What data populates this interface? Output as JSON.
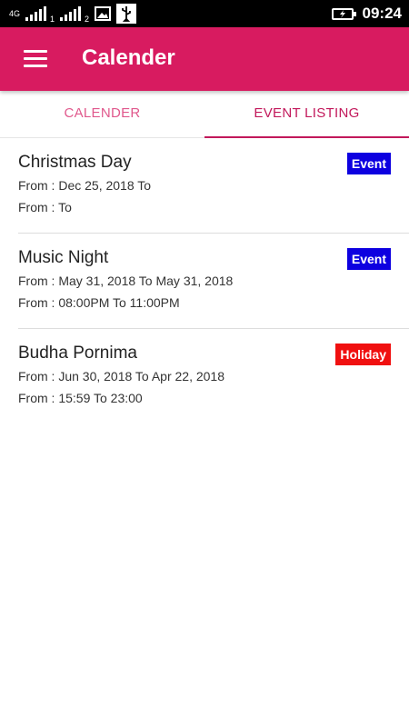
{
  "status_bar": {
    "network_type": "4G",
    "sim1": "1",
    "sim2": "2",
    "time": "09:24",
    "icons": [
      "signal-icon",
      "gallery-icon",
      "usb-icon",
      "battery-icon"
    ]
  },
  "app_bar": {
    "title": "Calender",
    "color": "#d81b60"
  },
  "tabs": [
    {
      "label": "CALENDER",
      "selected": false
    },
    {
      "label": "EVENT LISTING",
      "selected": true
    }
  ],
  "events": [
    {
      "title": "Christmas Day",
      "line1": "From : Dec 25, 2018 To",
      "line2": "From : To",
      "badge": "Event",
      "badge_color": "#0d00e0"
    },
    {
      "title": "Music Night",
      "line1": "From : May 31, 2018 To May 31, 2018",
      "line2": "From : 08:00PM To 11:00PM",
      "badge": "Event",
      "badge_color": "#0d00e0"
    },
    {
      "title": "Budha Pornima",
      "line1": "From : Jun 30, 2018 To Apr 22, 2018",
      "line2": "From : 15:59 To 23:00",
      "badge": "Holiday",
      "badge_color": "#f01010"
    }
  ]
}
